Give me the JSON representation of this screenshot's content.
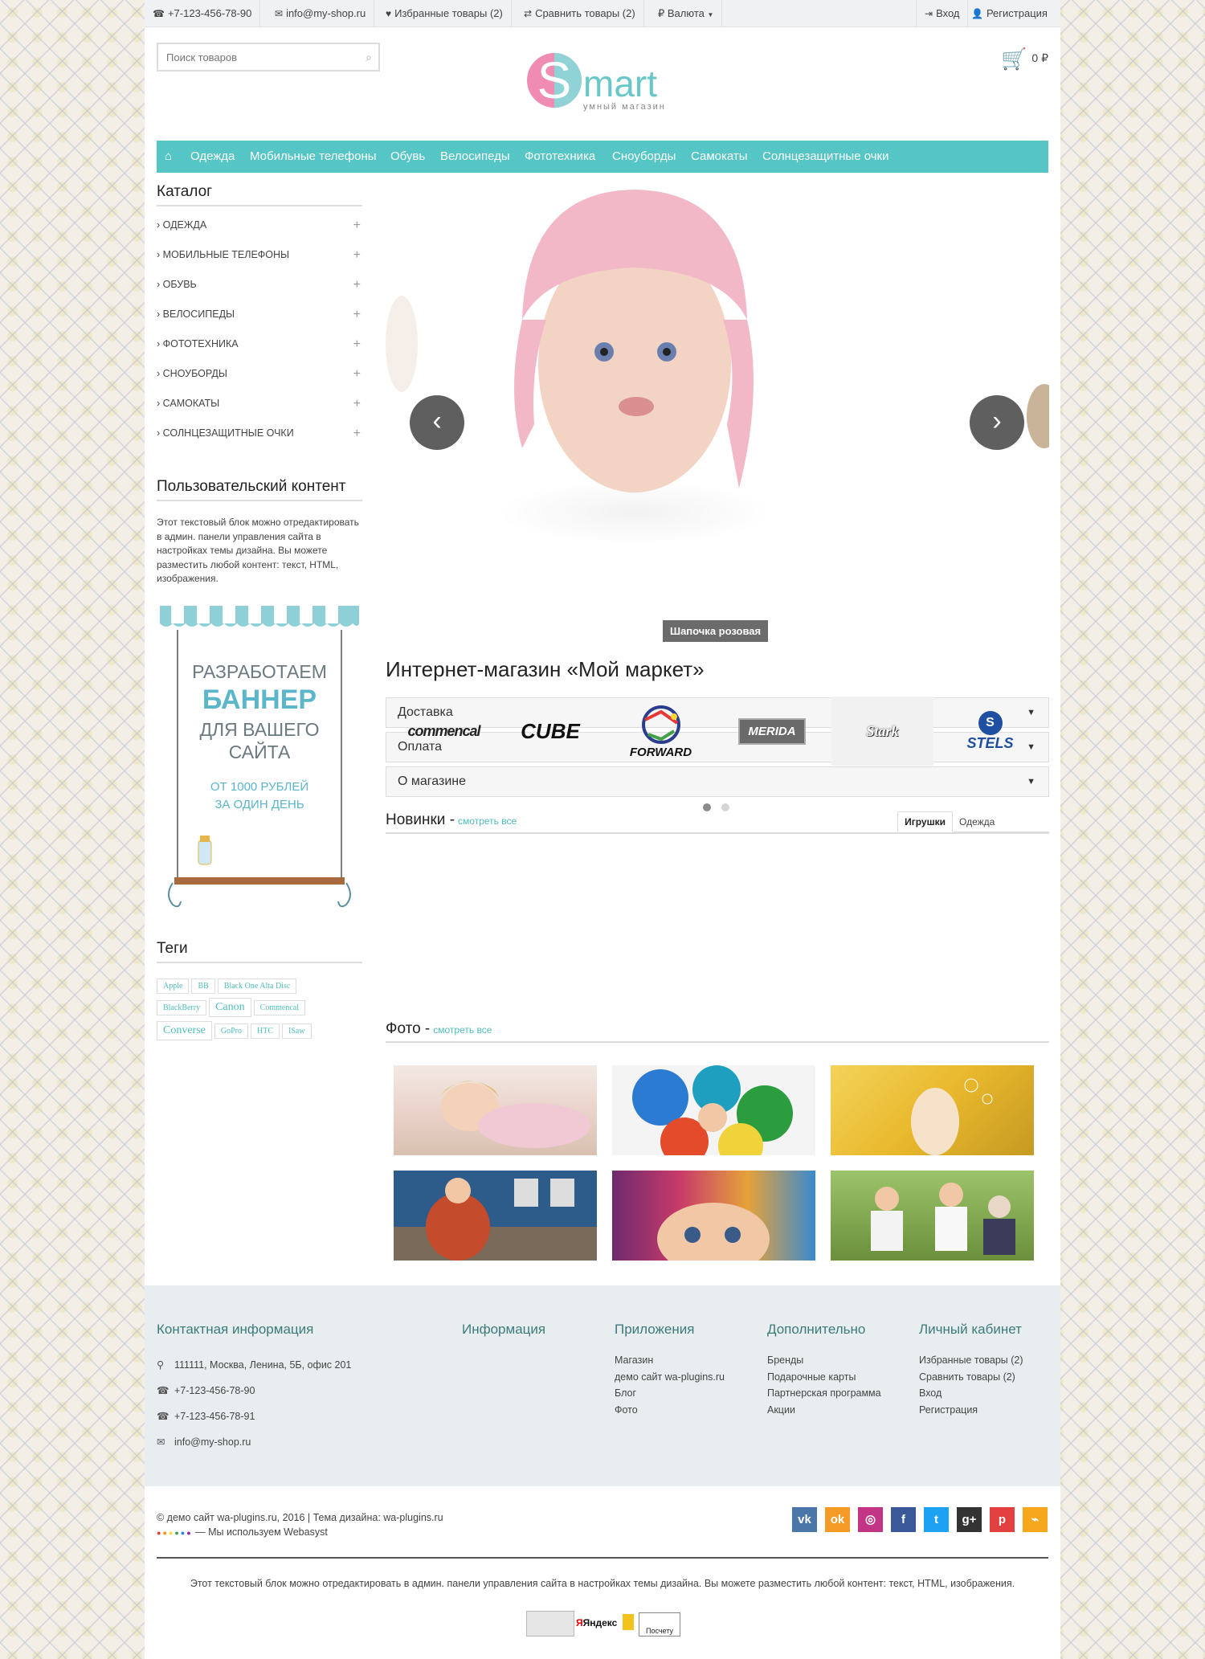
{
  "topbar": {
    "phone": "+7-123-456-78-90",
    "email": "info@my-shop.ru",
    "favorites": "Избранные товары (2)",
    "compare": "Сравнить товары (2)",
    "currency": "₽ Валюта",
    "login": "Вход",
    "register": "Регистрация"
  },
  "header": {
    "search_placeholder": "Поиск товаров",
    "logo_word": "mart",
    "logo_letter": "S",
    "logo_tagline": "умный магазин",
    "cart_total": "0 ₽"
  },
  "nav": {
    "items": [
      "Одежда",
      "Мобильные телефоны",
      "Обувь",
      "Велосипеды",
      "Фототехника",
      "Сноуборды",
      "Самокаты",
      "Солнцезащитные очки"
    ]
  },
  "sidebar": {
    "catalog_title": "Каталог",
    "categories": [
      "Одежда",
      "Мобильные телефоны",
      "Обувь",
      "Велосипеды",
      "Фототехника",
      "Сноуборды",
      "Самокаты",
      "Солнцезащитные очки"
    ],
    "user_content_title": "Пользовательский контент",
    "user_content_text": "Этот текстовый блок можно отредактировать в админ. панели управления сайта в настройках темы дизайна. Вы можете разместить любой контент: текст, HTML, изображения.",
    "banner": {
      "line1": "РАЗРАБОТАЕМ",
      "line2": "БАННЕР",
      "line3": "ДЛЯ ВАШЕГО",
      "line4": "САЙТА",
      "line5": "ОТ 1000 РУБЛЕЙ",
      "line6": "ЗА ОДИН ДЕНЬ"
    },
    "tags_title": "Теги",
    "tags": [
      "Apple",
      "BB",
      "Black One Alta Disc",
      "BlackBerry",
      "Canon",
      "Commencal",
      "Converse",
      "GoPro",
      "HTC",
      "ISaw"
    ]
  },
  "slider": {
    "caption": "Шапочка розовая",
    "prev": "‹",
    "next": "›"
  },
  "main": {
    "title": "Интернет-магазин «Мой маркет»",
    "accordion": [
      "Доставка",
      "Оплата",
      "О магазине"
    ],
    "new_title": "Новинки -",
    "new_more": "смотреть все",
    "tab_toys": "Игрушки",
    "tab_clothes": "Одежда",
    "brands": [
      "commencal",
      "CUBE",
      "FORWARD",
      "MERIDA",
      "Stark",
      "STELS"
    ],
    "photo_title": "Фото -",
    "photo_more": "смотреть все"
  },
  "footer": {
    "contacts_title": "Контактная информация",
    "address": "111111, Москва, Ленина, 5Б, офис 201",
    "phone1": "+7-123-456-78-90",
    "phone2": "+7-123-456-78-91",
    "email": "info@my-shop.ru",
    "info_title": "Информация",
    "apps_title": "Приложения",
    "apps": [
      "Магазин",
      "демо сайт wa-plugins.ru",
      "Блог",
      "Фото"
    ],
    "extra_title": "Дополнительно",
    "extra": [
      "Бренды",
      "Подарочные карты",
      "Партнерская программа",
      "Акции"
    ],
    "account_title": "Личный кабинет",
    "account": [
      "Избранные товары (2)",
      "Сравнить товары (2)",
      "Вход",
      "Регистрация"
    ],
    "copyright": "© демо сайт wa-plugins.ru, 2016 | Тема дизайна: wa-plugins.ru",
    "webasyst": "— Мы используем Webasyst",
    "bottom_text": "Этот текстовый блок можно отредактировать в админ. панели управления сайта в настройках темы дизайна. Вы можете разместить любой контент: текст, HTML, изображения.",
    "social": [
      "vk-icon",
      "odnoklassniki-icon",
      "instagram-icon",
      "facebook-icon",
      "twitter-icon",
      "google-plus-icon",
      "pinterest-icon",
      "rss-icon"
    ],
    "social_colors": [
      "#4a76a8",
      "#f59a24",
      "#c13584",
      "#3b5998",
      "#1da1f2",
      "#333333",
      "#e3413f",
      "#f7a71c"
    ],
    "counters": {
      "yandex": "Яндекс",
      "posetitel": "Посчету"
    }
  }
}
